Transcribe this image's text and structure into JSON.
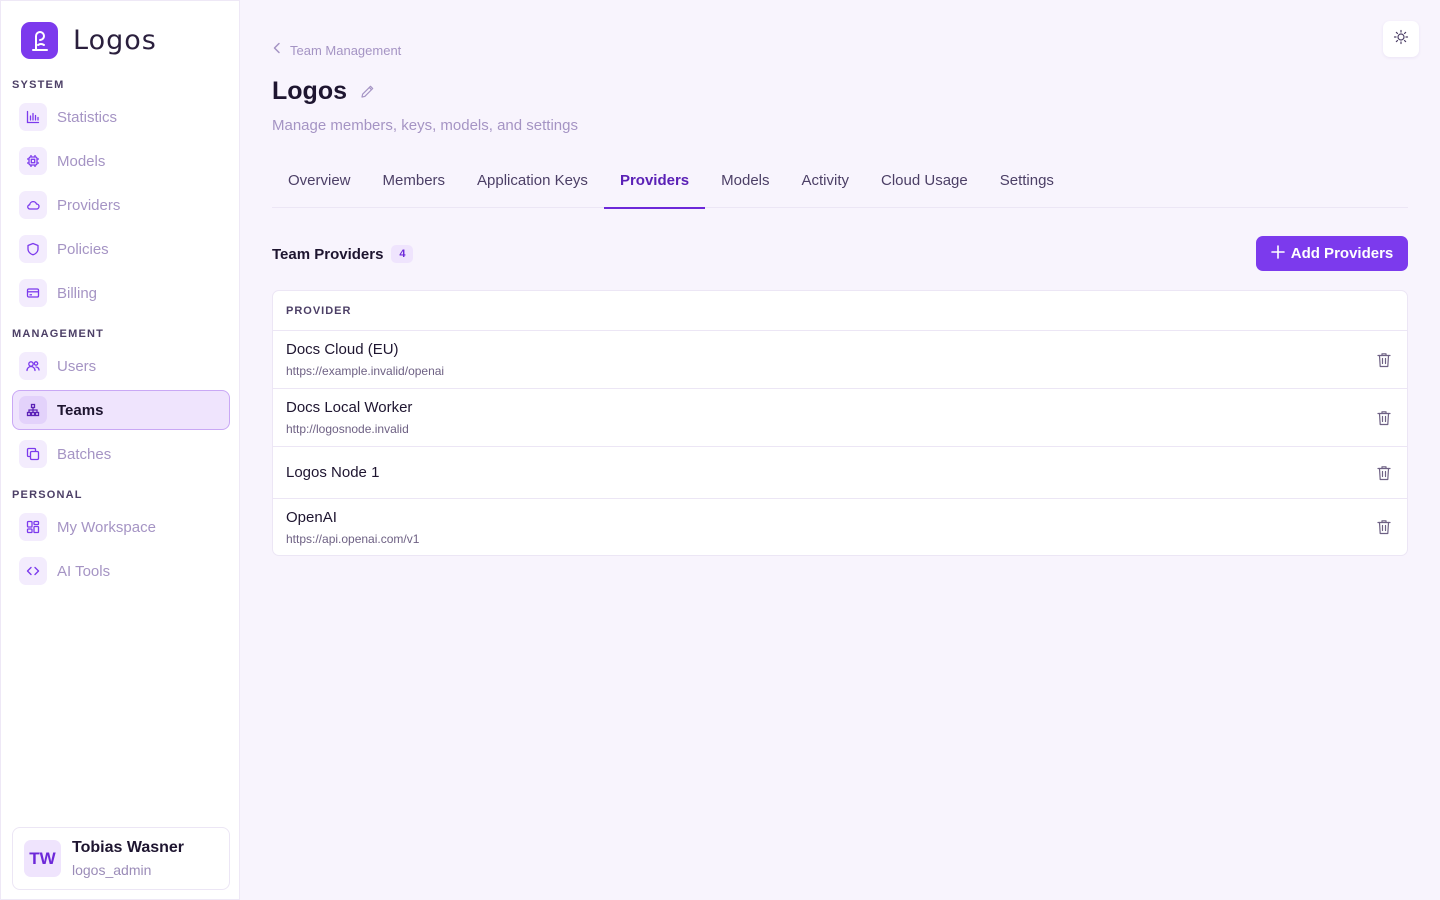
{
  "app": {
    "name": "Logos"
  },
  "sidebar": {
    "sections": {
      "system": "SYSTEM",
      "management": "MANAGEMENT",
      "personal": "PERSONAL"
    },
    "items": [
      {
        "label": "Statistics",
        "icon": "chart-icon"
      },
      {
        "label": "Models",
        "icon": "chip-icon"
      },
      {
        "label": "Providers",
        "icon": "cloud-icon"
      },
      {
        "label": "Policies",
        "icon": "shield-icon"
      },
      {
        "label": "Billing",
        "icon": "credit-card-icon"
      },
      {
        "label": "Users",
        "icon": "users-icon"
      },
      {
        "label": "Teams",
        "icon": "hierarchy-icon",
        "active": true
      },
      {
        "label": "Batches",
        "icon": "copy-icon"
      },
      {
        "label": "My Workspace",
        "icon": "grid-icon"
      },
      {
        "label": "AI Tools",
        "icon": "code-icon"
      }
    ]
  },
  "user": {
    "initials": "TW",
    "name": "Tobias Wasner",
    "role": "logos_admin"
  },
  "breadcrumb": {
    "label": "Team Management"
  },
  "page": {
    "title": "Logos",
    "subtitle": "Manage members, keys, models, and settings"
  },
  "tabs": [
    {
      "label": "Overview"
    },
    {
      "label": "Members"
    },
    {
      "label": "Application Keys"
    },
    {
      "label": "Providers",
      "active": true
    },
    {
      "label": "Models"
    },
    {
      "label": "Activity"
    },
    {
      "label": "Cloud Usage"
    },
    {
      "label": "Settings"
    }
  ],
  "providers_section": {
    "heading": "Team Providers",
    "count": "4",
    "add_label": "Add Providers",
    "column_header": "PROVIDER",
    "rows": [
      {
        "name": "Docs Cloud (EU)",
        "url": "https://example.invalid/openai"
      },
      {
        "name": "Docs Local Worker",
        "url": "http://logosnode.invalid"
      },
      {
        "name": "Logos Node 1",
        "url": ""
      },
      {
        "name": "OpenAI",
        "url": "https://api.openai.com/v1"
      }
    ]
  },
  "colors": {
    "accent": "#7c3aed",
    "background": "#f8f4fd",
    "muted_text": "#a594c4"
  }
}
